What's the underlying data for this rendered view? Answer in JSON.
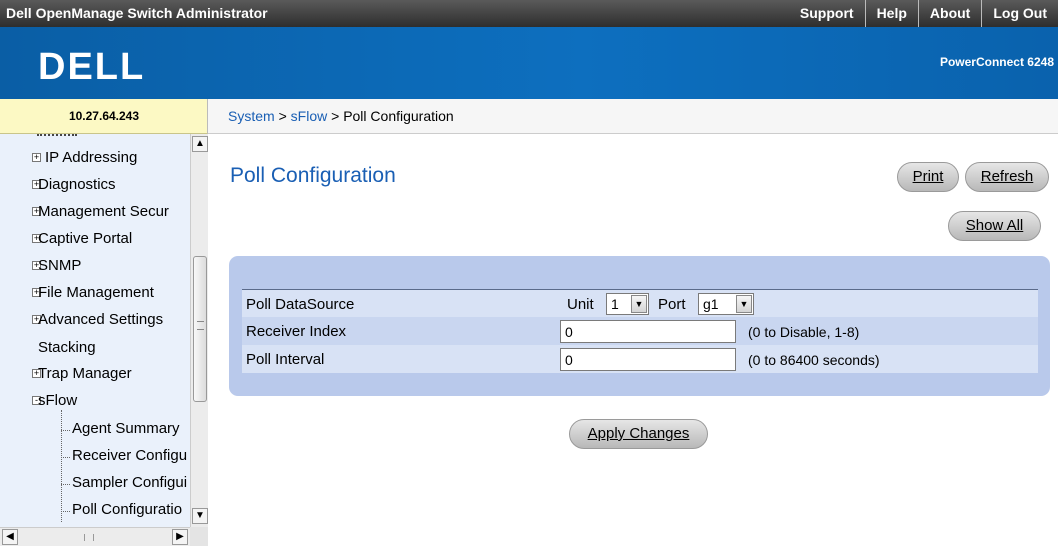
{
  "header": {
    "app_title": "Dell OpenManage Switch Administrator",
    "links": [
      "Support",
      "Help",
      "About",
      "Log Out"
    ]
  },
  "banner": {
    "logo_text": "DELL",
    "model": "PowerConnect 6248"
  },
  "device_ip": "10.27.64.243",
  "breadcrumb": {
    "system": "System",
    "sflow": "sFlow",
    "current": "Poll Configuration",
    "separator": ">"
  },
  "sidebar": {
    "items": [
      {
        "label": "IP Addressing",
        "expander": "+"
      },
      {
        "label": "Diagnostics",
        "expander": "+"
      },
      {
        "label": "Management Secur",
        "expander": "+"
      },
      {
        "label": "Captive Portal",
        "expander": "+"
      },
      {
        "label": "SNMP",
        "expander": "+"
      },
      {
        "label": "File Management",
        "expander": "+"
      },
      {
        "label": "Advanced Settings",
        "expander": "+"
      },
      {
        "label": "Stacking",
        "expander": ""
      },
      {
        "label": "Trap Manager",
        "expander": "+"
      },
      {
        "label": "sFlow",
        "expander": "-"
      }
    ],
    "children": [
      "Agent Summary",
      "Receiver Configu",
      "Sampler Configui",
      "Poll Configuratio"
    ]
  },
  "main": {
    "title": "Poll Configuration",
    "print_label": "Print",
    "refresh_label": "Refresh",
    "show_all_label": "Show All",
    "apply_label": "Apply Changes",
    "rows": {
      "datasource": {
        "label": "Poll DataSource",
        "unit_label": "Unit",
        "unit_value": "1",
        "port_label": "Port",
        "port_value": "g1"
      },
      "receiver": {
        "label": "Receiver Index",
        "value": "0",
        "hint": "(0 to Disable, 1-8)"
      },
      "interval": {
        "label": "Poll Interval",
        "value": "0",
        "hint": "(0 to 86400 seconds)"
      }
    }
  },
  "colors": {
    "accent": "#1a5fb4",
    "banner": "#0d6fbf",
    "panel": "#b9c9eb",
    "ip_bg": "#fcf9c4"
  }
}
